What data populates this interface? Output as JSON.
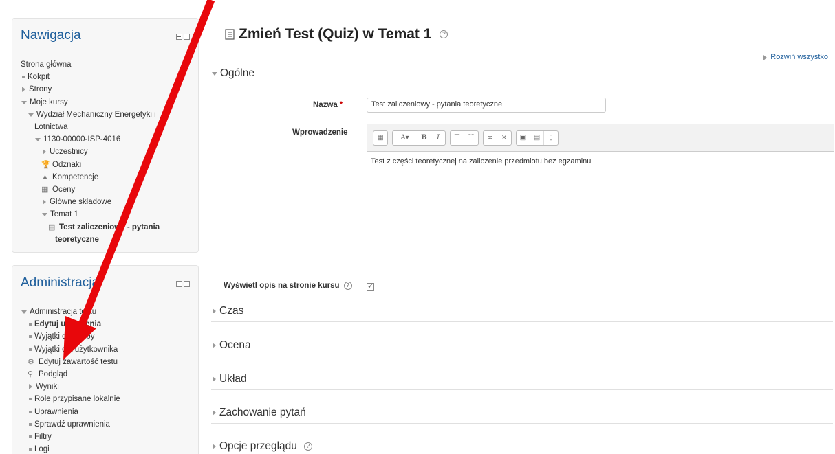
{
  "nav": {
    "title": "Nawigacja",
    "items": [
      {
        "label": "Strona główna",
        "icon": "none",
        "indent": 0
      },
      {
        "label": "Kokpit",
        "icon": "bullet",
        "indent": 0
      },
      {
        "label": "Strony",
        "icon": "tri-right",
        "indent": 0
      },
      {
        "label": "Moje kursy",
        "icon": "tri-down",
        "indent": 0
      },
      {
        "label": "Wydział Mechaniczny Energetyki i",
        "icon": "tri-down",
        "indent": 1
      },
      {
        "label": "Lotnictwa",
        "icon": "none",
        "indent": 2
      },
      {
        "label": "1130-00000-ISP-4016",
        "icon": "tri-down",
        "indent": 2
      },
      {
        "label": "Uczestnicy",
        "icon": "tri-right",
        "indent": 3
      },
      {
        "label": "Odznaki",
        "icon": "trophy-icon",
        "indent": 3
      },
      {
        "label": "Kompetencje",
        "icon": "competency-icon",
        "indent": 3
      },
      {
        "label": "Oceny",
        "icon": "grades-icon",
        "indent": 3
      },
      {
        "label": "Główne składowe",
        "icon": "tri-right",
        "indent": 3
      },
      {
        "label": "Temat 1",
        "icon": "tri-down",
        "indent": 3
      },
      {
        "label": "Test zaliczeniowy - pytania",
        "icon": "quiz-icon",
        "indent": 4,
        "bold": true
      },
      {
        "label": "teoretyczne",
        "icon": "none",
        "indent": 5,
        "bold": true
      }
    ]
  },
  "admin": {
    "title": "Administracja",
    "items": [
      {
        "label": "Administracja testu",
        "icon": "tri-down",
        "indent": 0
      },
      {
        "label": "Edytuj ustawienia",
        "icon": "bullet",
        "indent": 1,
        "bold": true
      },
      {
        "label": "Wyjątki dla grupy",
        "icon": "bullet",
        "indent": 1
      },
      {
        "label": "Wyjątki dla użytkownika",
        "icon": "bullet",
        "indent": 1
      },
      {
        "label": "Edytuj zawartość testu",
        "icon": "gear-icon",
        "indent": 1
      },
      {
        "label": "Podgląd",
        "icon": "search-icon",
        "indent": 1
      },
      {
        "label": "Wyniki",
        "icon": "tri-right",
        "indent": 1
      },
      {
        "label": "Role przypisane lokalnie",
        "icon": "bullet",
        "indent": 1
      },
      {
        "label": "Uprawnienia",
        "icon": "bullet",
        "indent": 1
      },
      {
        "label": "Sprawdź uprawnienia",
        "icon": "bullet",
        "indent": 1
      },
      {
        "label": "Filtry",
        "icon": "bullet",
        "indent": 1
      },
      {
        "label": "Logi",
        "icon": "bullet",
        "indent": 1
      }
    ]
  },
  "main": {
    "title": "Zmień Test (Quiz) w Temat 1",
    "expand_all": "Rozwiń wszystko",
    "sections": {
      "ogolne": "Ogólne",
      "czas": "Czas",
      "ocena": "Ocena",
      "uklad": "Układ",
      "zachowanie": "Zachowanie pytań",
      "opcje": "Opcje przeglądu"
    },
    "form": {
      "nazwa_label": "Nazwa",
      "nazwa_value": "Test zaliczeniowy - pytania teoretyczne",
      "wprowadzenie_label": "Wprowadzenie",
      "editor_text": "Test z części teoretycznej na zaliczenie przedmiotu bez egzaminu",
      "wyswietl_label": "Wyświetl opis na stronie kursu",
      "wyswietl_checked": "✓"
    }
  },
  "colors": {
    "arrow": "#e8070b",
    "link": "#1f5f9c",
    "required": "#cc0000"
  }
}
